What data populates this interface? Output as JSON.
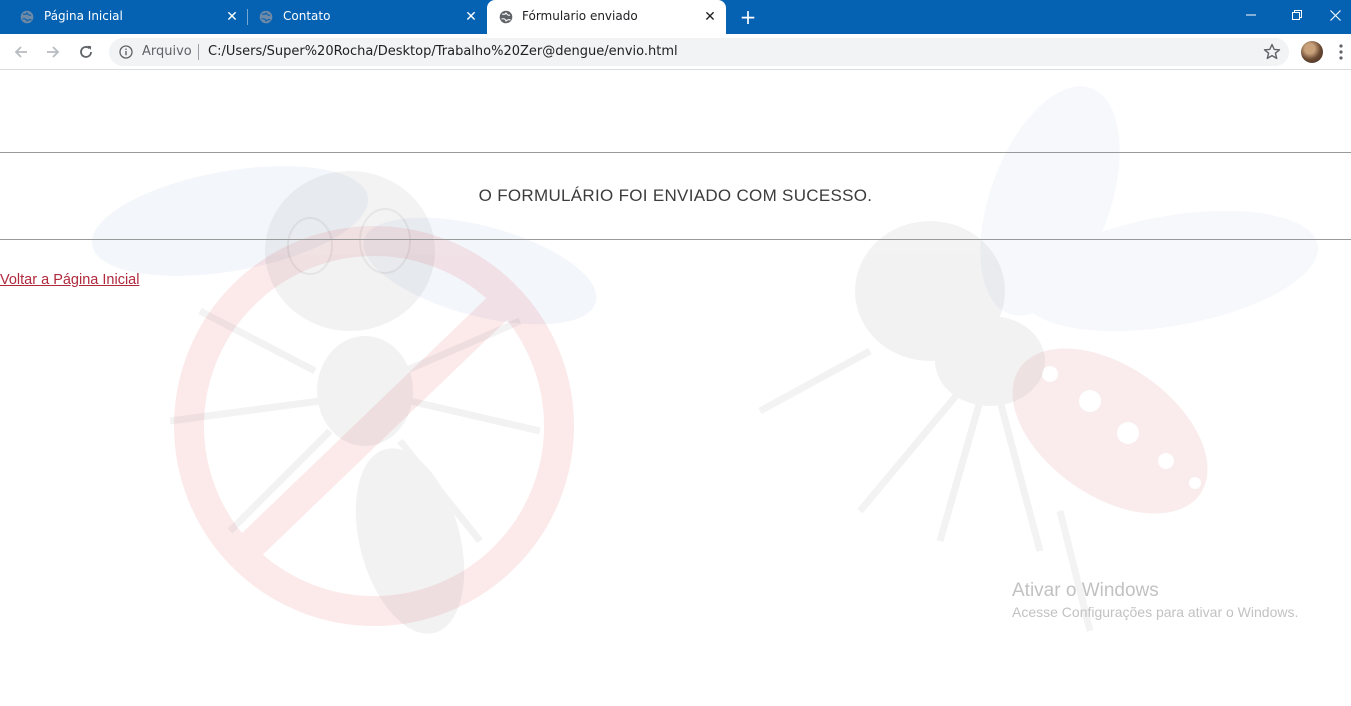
{
  "tabs": [
    {
      "title": "Página Inicial",
      "active": false
    },
    {
      "title": "Contato",
      "active": false
    },
    {
      "title": "Fórmulario enviado",
      "active": true
    }
  ],
  "toolbar": {
    "scheme_label": "Arquivo",
    "url": "C:/Users/Super%20Rocha/Desktop/Trabalho%20Zer@dengue/envio.html"
  },
  "page": {
    "message": "O FORMULÁRIO FOI ENVIADO COM SUCESSO.",
    "back_link": "Voltar a Página Inicial"
  },
  "watermark": {
    "title": "Ativar o Windows",
    "subtitle": "Acesse Configurações para ativar o Windows."
  },
  "colors": {
    "tabstrip": "#0561b2",
    "link": "#b0283c",
    "message_text": "#3c3c3c"
  }
}
